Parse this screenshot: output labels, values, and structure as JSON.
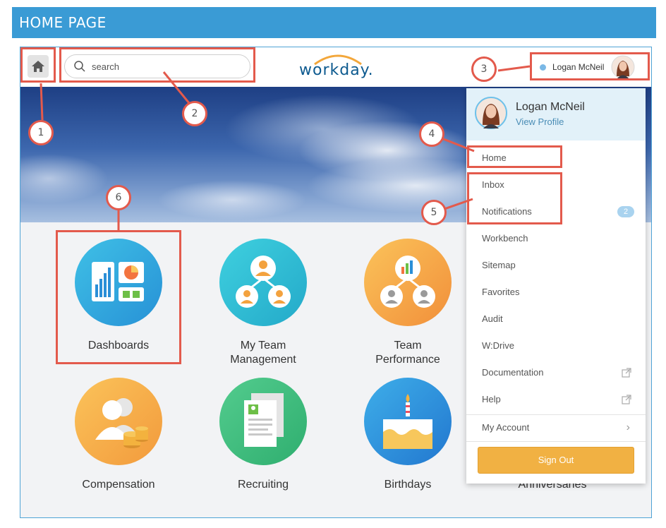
{
  "banner": {
    "title": "HOME PAGE"
  },
  "topbar": {
    "search_placeholder": "search",
    "logo_text": "workday",
    "logo_dot": ".",
    "user_name": "Logan McNeil"
  },
  "apps": [
    {
      "label": "Dashboards",
      "icon": "dashboards-icon",
      "color": "#2aa8d8"
    },
    {
      "label": "My Team\nManagement",
      "icon": "team-management-icon",
      "color": "#2bbcd2"
    },
    {
      "label": "Team\nPerformance",
      "icon": "team-performance-icon",
      "color": "#f7a64a"
    },
    {
      "label": "Compensation",
      "icon": "compensation-icon",
      "color": "#f5a747"
    },
    {
      "label": "Recruiting",
      "icon": "recruiting-icon",
      "color": "#3dbb7d"
    },
    {
      "label": "Birthdays",
      "icon": "birthday-cake-icon",
      "color": "#2e97e0"
    },
    {
      "label": "Anniversaries",
      "icon": "anniversaries-icon"
    }
  ],
  "menu": {
    "name": "Logan McNeil",
    "view_profile": "View Profile",
    "items": [
      {
        "label": "Home"
      },
      {
        "label": "Inbox"
      },
      {
        "label": "Notifications",
        "badge": "2"
      },
      {
        "label": "Workbench"
      },
      {
        "label": "Sitemap"
      },
      {
        "label": "Favorites"
      },
      {
        "label": "Audit"
      },
      {
        "label": "W:Drive"
      },
      {
        "label": "Documentation",
        "icon": "external-link-icon"
      },
      {
        "label": "Help",
        "icon": "external-link-icon"
      }
    ],
    "my_account": "My Account",
    "sign_out": "Sign Out"
  },
  "annotations": [
    "1",
    "2",
    "3",
    "4",
    "5",
    "6"
  ],
  "colors": {
    "banner": "#3a9bd5",
    "annotation": "#e35a4c",
    "sign_out": "#f1b143",
    "profile_header": "#e2f1f9",
    "link": "#4a8db6"
  }
}
